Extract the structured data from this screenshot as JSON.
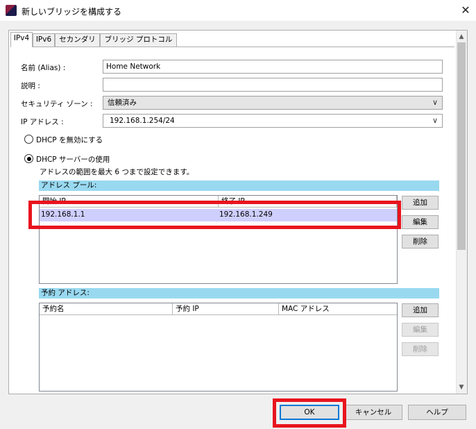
{
  "window": {
    "title": "新しいブリッジを構成する",
    "close_glyph": "✕"
  },
  "tabs": [
    {
      "label": "IPv4",
      "active": true
    },
    {
      "label": "IPv6",
      "active": false
    },
    {
      "label": "セカンダリ",
      "active": false
    },
    {
      "label": "ブリッジ プロトコル",
      "active": false
    }
  ],
  "form": {
    "alias_label": "名前 (Alias) :",
    "alias_value": "Home Network",
    "description_label": "説明 :",
    "description_value": "",
    "zone_label": "セキュリティ ゾーン :",
    "zone_value": "信頼済み",
    "ip_label": "IP アドレス :",
    "ip_value": "192.168.1.254/24"
  },
  "dhcp": {
    "option_disable": "DHCP を無効にする",
    "option_server": "DHCP サーバーの使用",
    "selected": "server",
    "note": "アドレスの範囲を最大 6 つまで設定できます。"
  },
  "address_pool": {
    "heading": "アドレス プール:",
    "columns": [
      "開始 IP",
      "終了 IP"
    ],
    "rows": [
      {
        "start": "192.168.1.1",
        "end": "192.168.1.249"
      }
    ],
    "buttons": {
      "add": "追加",
      "edit": "編集",
      "delete": "削除"
    }
  },
  "reserved": {
    "heading": "予約 アドレス:",
    "columns": [
      "予約名",
      "予約 IP",
      "MAC アドレス"
    ],
    "buttons": {
      "add": "追加",
      "edit": "編集",
      "delete": "削除"
    }
  },
  "footer": {
    "ok": "OK",
    "cancel": "キャンセル",
    "help": "ヘルプ"
  },
  "colors": {
    "highlight": "#e8141e",
    "section_header": "#99d9f0",
    "row_selected": "#cfcfff",
    "focus_border": "#0078d7"
  },
  "icons": {
    "chevron": "chevron-down-icon",
    "app": "app-icon",
    "close": "close-icon"
  }
}
